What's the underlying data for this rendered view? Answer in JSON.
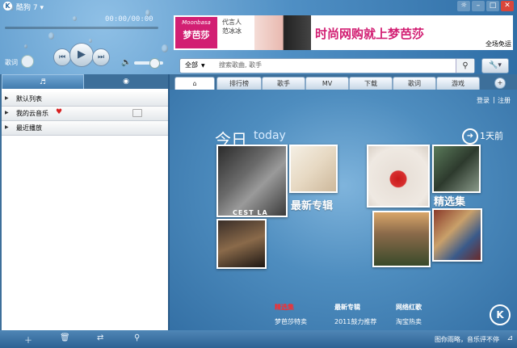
{
  "window": {
    "title": "酷狗 7",
    "title_arrow": "▾",
    "min_btn": "–",
    "max_btn": "□",
    "close_btn": "✕",
    "skin_btn": "☼"
  },
  "player": {
    "time": "00:00/00:00",
    "progress": 0,
    "lyrics_label": "歌词",
    "volume_level": 0.7
  },
  "ad": {
    "brand_en": "Moonbasa",
    "brand_cn": "梦芭莎",
    "spokes_1": "代言人",
    "spokes_2": "范冰冰",
    "slogan": "时尚网购就上梦芭莎",
    "footer": "全场免运"
  },
  "search": {
    "category": "全部",
    "placeholder": "搜索歌曲, 歌手"
  },
  "left_tabs": [
    {
      "name": "music-tab",
      "icon": "music-note-icon"
    },
    {
      "name": "radio-tab",
      "icon": "disc-icon"
    }
  ],
  "playlists": [
    {
      "label": "默认列表"
    },
    {
      "label": "我的云音乐"
    },
    {
      "label": "最近播放"
    }
  ],
  "main_tabs": [
    {
      "label": "排行榜"
    },
    {
      "label": "歌手"
    },
    {
      "label": "MV"
    },
    {
      "label": "下载"
    },
    {
      "label": "歌词"
    },
    {
      "label": "游戏"
    }
  ],
  "account": {
    "login": "登录",
    "separator": "|",
    "register": "注册"
  },
  "today": {
    "cn": "今日",
    "en": "today",
    "days_ago": "1天前",
    "new_album_label": "最新专辑",
    "featured_label": "精选集",
    "cover_text": "CEST LA"
  },
  "links": [
    {
      "header": "精选集",
      "item": "梦芭莎特卖"
    },
    {
      "header": "最新专辑",
      "item": "2011鼓力推荐"
    },
    {
      "header": "网络红歌",
      "item": "淘宝热卖"
    }
  ],
  "status": {
    "text": "图你雨略，音乐评不停"
  },
  "colors": {
    "accent": "#2f6ea6",
    "brand": "#d21f73",
    "header_red": "#ff2a2a"
  }
}
